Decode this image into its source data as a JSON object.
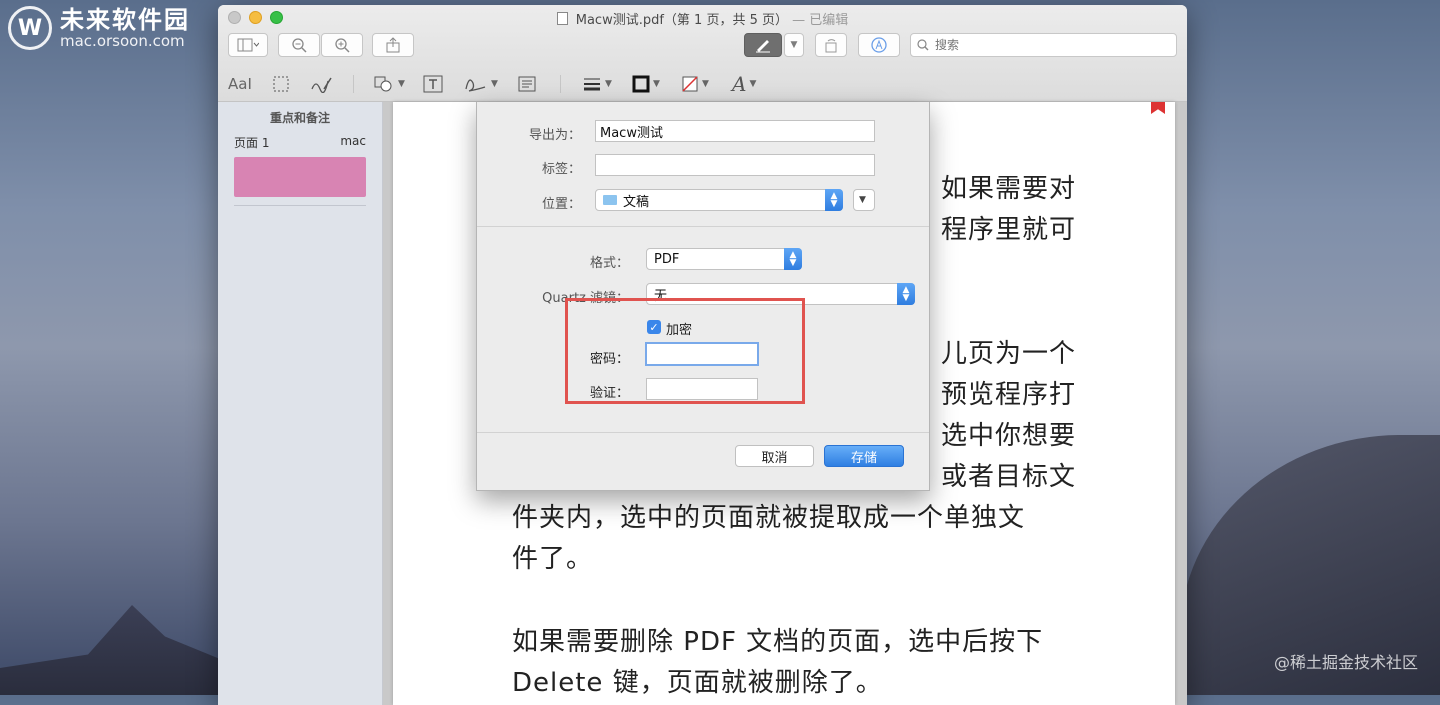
{
  "watermark": {
    "logo_text": "未来软件园",
    "logo_sub": "mac.orsoon.com",
    "corner_text": "@稀土掘金技术社区"
  },
  "window": {
    "title": "Macw测试.pdf（第 1 页，共 5 页）",
    "edited_suffix": "— 已编辑",
    "search_placeholder": "搜索"
  },
  "sidebar": {
    "heading": "重点和备注",
    "page_label": "页面 1",
    "author": "mac"
  },
  "document": {
    "lines": [
      "如果需要对",
      "程序里就可",
      "儿页为一个",
      "预览程序打",
      "选中你想要",
      "或者目标文",
      "件夹内，选中的页面就被提取成一个单独文",
      "件了。",
      "如果需要删除 PDF 文档的页面，选中后按下",
      "Delete 键，页面就被删除了。"
    ]
  },
  "export_sheet": {
    "export_as_label": "导出为：",
    "export_as_value": "Macw测试",
    "tags_label": "标签：",
    "location_label": "位置：",
    "location_value": "文稿",
    "format_label": "格式：",
    "format_value": "PDF",
    "quartz_label": "Quartz 滤镜：",
    "quartz_value": "无",
    "encrypt_label": "加密",
    "encrypt_checked": true,
    "password_label": "密码：",
    "verify_label": "验证：",
    "cancel_label": "取消",
    "save_label": "存储"
  }
}
